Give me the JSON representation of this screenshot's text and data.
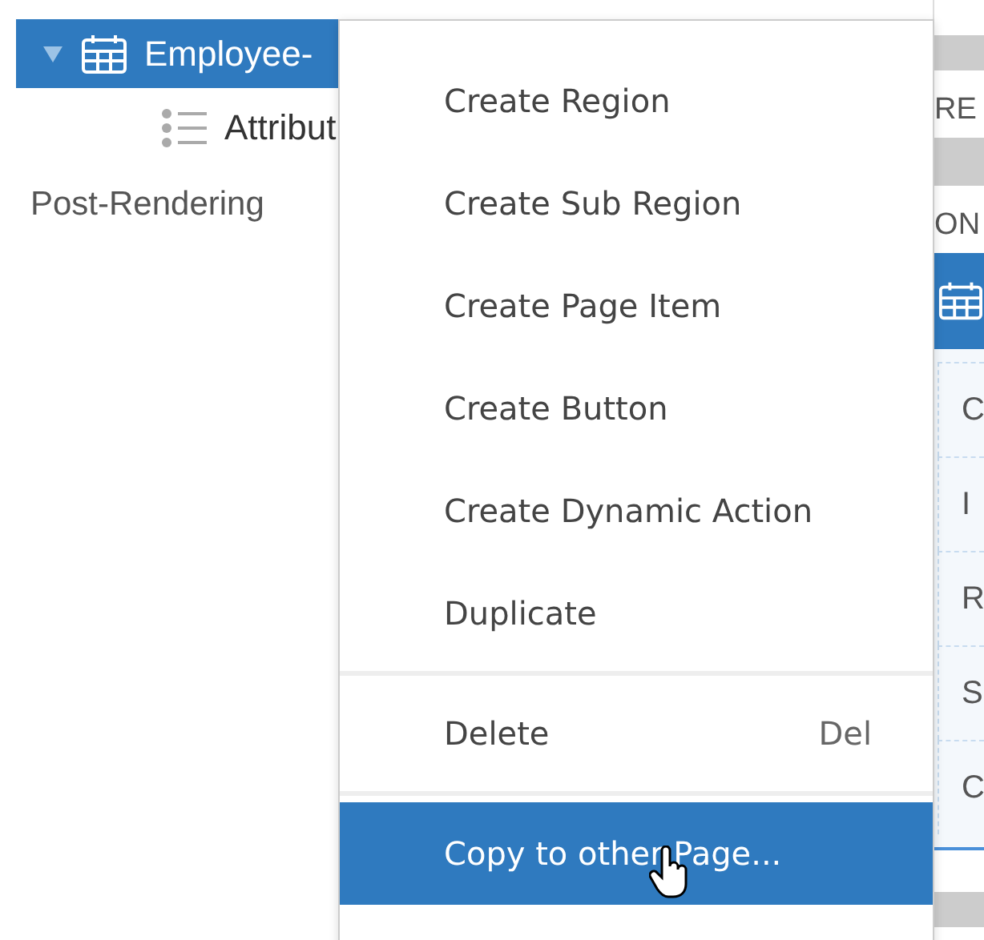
{
  "tree": [
    {
      "label": "Employee-",
      "kind": "region",
      "selected": true,
      "expanded": true
    },
    {
      "label": "Attribut",
      "kind": "attributes",
      "selected": false
    },
    {
      "label": "Post-Rendering",
      "kind": "section",
      "selected": false
    }
  ],
  "right_panel": {
    "labels": [
      "RE",
      "ON"
    ],
    "rows": [
      "C",
      "I",
      "R",
      "S",
      "C"
    ]
  },
  "context_menu": [
    {
      "label": "Create Region",
      "selected": false
    },
    {
      "label": "Create Sub Region",
      "selected": false
    },
    {
      "label": "Create Page Item",
      "selected": false
    },
    {
      "label": "Create Button",
      "selected": false
    },
    {
      "label": "Create Dynamic Action",
      "selected": false
    },
    {
      "label": "Duplicate",
      "selected": false,
      "separator_after": true
    },
    {
      "label": "Delete",
      "shortcut": "Del",
      "selected": false,
      "separator_after": true
    },
    {
      "label": "Copy to other Page...",
      "selected": true
    }
  ]
}
